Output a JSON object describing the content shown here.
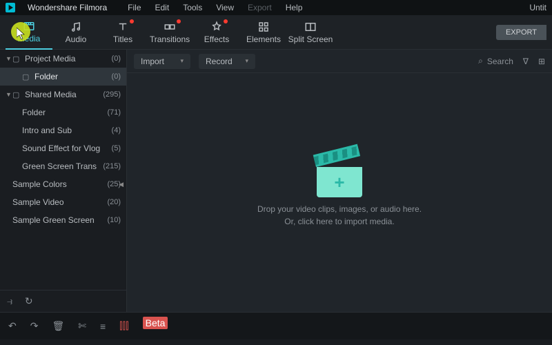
{
  "app": {
    "name": "Wondershare Filmora",
    "doc": "Untit"
  },
  "menu": [
    "File",
    "Edit",
    "Tools",
    "View",
    "Export",
    "Help"
  ],
  "menu_dim_index": 4,
  "tabs": [
    {
      "label": "Media",
      "icon": "media",
      "active": true,
      "dot": false
    },
    {
      "label": "Audio",
      "icon": "audio",
      "dot": false
    },
    {
      "label": "Titles",
      "icon": "titles",
      "dot": true
    },
    {
      "label": "Transitions",
      "icon": "transitions",
      "dot": true
    },
    {
      "label": "Effects",
      "icon": "effects",
      "dot": true
    },
    {
      "label": "Elements",
      "icon": "elements",
      "dot": false
    },
    {
      "label": "Split Screen",
      "icon": "split",
      "dot": false
    }
  ],
  "export_btn": "EXPORT",
  "sidebar": {
    "items": [
      {
        "label": "Project Media",
        "count": "(0)",
        "caret": "▼",
        "folder": true,
        "indent": 0
      },
      {
        "label": "Folder",
        "count": "(0)",
        "caret": "",
        "folder": true,
        "indent": 1,
        "sel": true
      },
      {
        "label": "Shared Media",
        "count": "(295)",
        "caret": "▼",
        "folder": true,
        "indent": 0
      },
      {
        "label": "Folder",
        "count": "(71)",
        "caret": "",
        "folder": false,
        "indent": 1
      },
      {
        "label": "Intro and Sub",
        "count": "(4)",
        "caret": "",
        "folder": false,
        "indent": 1
      },
      {
        "label": "Sound Effect for Vlog",
        "count": "(5)",
        "caret": "",
        "folder": false,
        "indent": 1
      },
      {
        "label": "Green Screen Trans",
        "count": "(215)",
        "caret": "",
        "folder": false,
        "indent": 1
      },
      {
        "label": "Sample Colors",
        "count": "(25)",
        "caret": "",
        "folder": false,
        "indent": 0,
        "collapse": "◀"
      },
      {
        "label": "Sample Video",
        "count": "(20)",
        "caret": "",
        "folder": false,
        "indent": 0
      },
      {
        "label": "Sample Green Screen",
        "count": "(10)",
        "caret": "",
        "folder": false,
        "indent": 0
      }
    ]
  },
  "content": {
    "import": "Import",
    "record": "Record",
    "search": "Search",
    "drop1": "Drop your video clips, images, or audio here.",
    "drop2": "Or, click here to import media."
  },
  "beta": "Beta"
}
